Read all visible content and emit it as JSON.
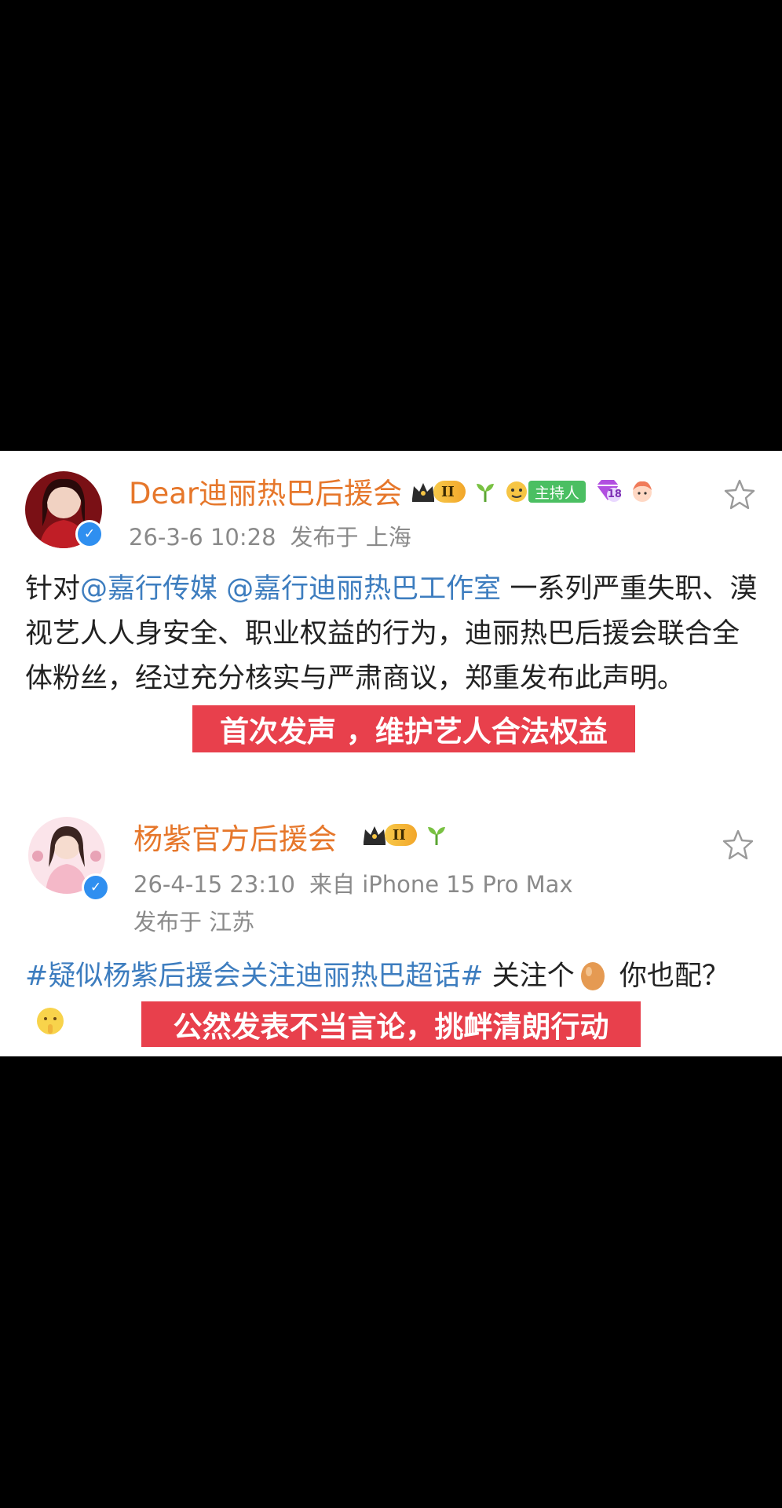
{
  "post1": {
    "author": "Dear迪丽热巴后援会",
    "crown_level": "II",
    "host_badge": "主持人",
    "vip_level": "18",
    "time": "26-3-6 10:28",
    "location": "发布于 上海",
    "text_lead": "针对",
    "mention_1": "@嘉行传媒",
    "mention_2": "@嘉行迪丽热巴工作室",
    "text_body": " 一系列严重失职、漠视艺人人身安全、职业权益的行为，迪丽热巴后援会联合全体粉丝，经过充分核实与严肃商议，郑重发布此声明。",
    "overlay": "首次发声 ，维护艺人合法权益"
  },
  "post2": {
    "author": "杨紫官方后援会",
    "crown_level": "II",
    "time": "26-4-15 23:10",
    "source": "来自 iPhone 15 Pro Max",
    "location": "发布于 江苏",
    "hashtag": "#疑似杨紫后援会关注迪丽热巴超话#",
    "text_a": " 关注个",
    "text_b": " 你也配？",
    "overlay": "公然发表不当言论，挑衅清朗行动"
  },
  "icons": [
    "verified-icon",
    "crown-icon",
    "sprout-icon",
    "star-icon",
    "egg-emoji-icon",
    "shush-emoji-icon"
  ],
  "colors": {
    "name": "#e6772b",
    "link": "#3d7dbf",
    "overlay": "#e8404c",
    "verified": "#2f8ff0"
  }
}
